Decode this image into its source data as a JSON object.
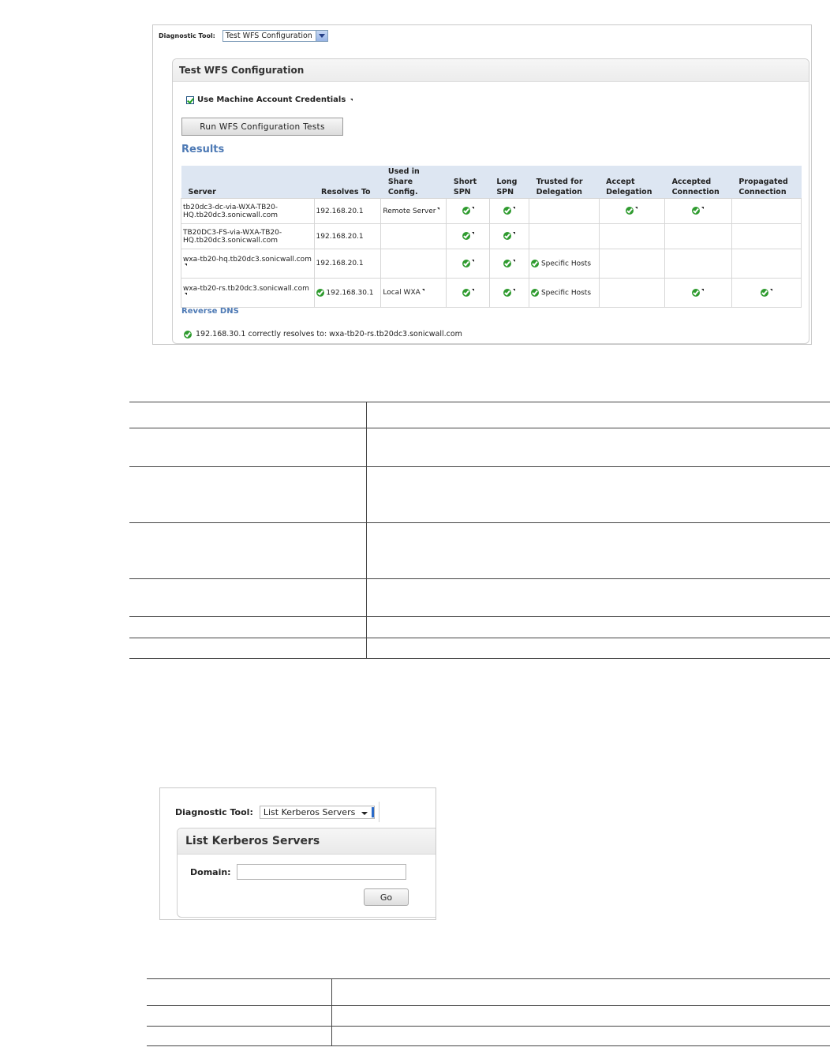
{
  "wfs": {
    "diagnostic_tool_label": "Diagnostic Tool:",
    "diagnostic_tool_value": "Test WFS Configuration",
    "panel_title": "Test WFS Configuration",
    "checkbox_label": "Use Machine Account Credentials",
    "checkbox_checked": true,
    "run_button": "Run WFS Configuration Tests",
    "results_title": "Results",
    "columns": [
      {
        "line1": "",
        "line2": "Server"
      },
      {
        "line1": "",
        "line2": "Resolves To"
      },
      {
        "line1": "Used in",
        "line2": "Share Config."
      },
      {
        "line1": "Short",
        "line2": "SPN"
      },
      {
        "line1": "Long",
        "line2": "SPN"
      },
      {
        "line1": "Trusted for",
        "line2": "Delegation"
      },
      {
        "line1": "Accept",
        "line2": "Delegation"
      },
      {
        "line1": "Accepted",
        "line2": "Connection"
      },
      {
        "line1": "Propagated",
        "line2": "Connection"
      }
    ],
    "rows": [
      {
        "server_line1": "tb20dc3-dc-via-WXA-TB20-",
        "server_line2": "HQ.tb20dc3.sonicwall.com",
        "resolves_to": "192.168.20.1",
        "share_config": "Remote Server",
        "short_spn": true,
        "long_spn": true,
        "trusted_text": "",
        "trusted": false,
        "accept_delegation": true,
        "accepted_connection": true,
        "propagated_connection": false
      },
      {
        "server_line1": "TB20DC3-FS-via-WXA-TB20-",
        "server_line2": "HQ.tb20dc3.sonicwall.com",
        "resolves_to": "192.168.20.1",
        "share_config": "",
        "short_spn": true,
        "long_spn": true,
        "trusted_text": "",
        "trusted": false,
        "accept_delegation": false,
        "accepted_connection": false,
        "propagated_connection": false
      },
      {
        "server_line1": "wxa-tb20-hq.tb20dc3.sonicwall.com",
        "server_line2": "",
        "resolves_to": "192.168.20.1",
        "share_config": "",
        "short_spn": true,
        "long_spn": true,
        "trusted_text": "Specific Hosts",
        "trusted": true,
        "accept_delegation": false,
        "accepted_connection": false,
        "propagated_connection": false
      },
      {
        "server_line1": "wxa-tb20-rs.tb20dc3.sonicwall.com",
        "server_line2": "",
        "resolves_to": "192.168.30.1",
        "share_config": "Local WXA",
        "short_spn": true,
        "long_spn": true,
        "trusted_text": "Specific Hosts",
        "trusted": true,
        "accept_delegation": false,
        "accepted_connection": true,
        "propagated_connection": true
      }
    ],
    "reverse_dns_title": "Reverse DNS",
    "reverse_dns_result": "192.168.30.1 correctly resolves to: wxa-tb20-rs.tb20dc3.sonicwall.com"
  },
  "kerberos": {
    "diagnostic_tool_label": "Diagnostic Tool:",
    "diagnostic_tool_value": "List Kerberos Servers",
    "panel_title": "List Kerberos Servers",
    "domain_label": "Domain:",
    "domain_value": "",
    "go_button": "Go"
  },
  "colors": {
    "accent_blue": "#4e7ab5",
    "header_blue": "#dde6f2",
    "ok_green": "#2f9b2f"
  }
}
